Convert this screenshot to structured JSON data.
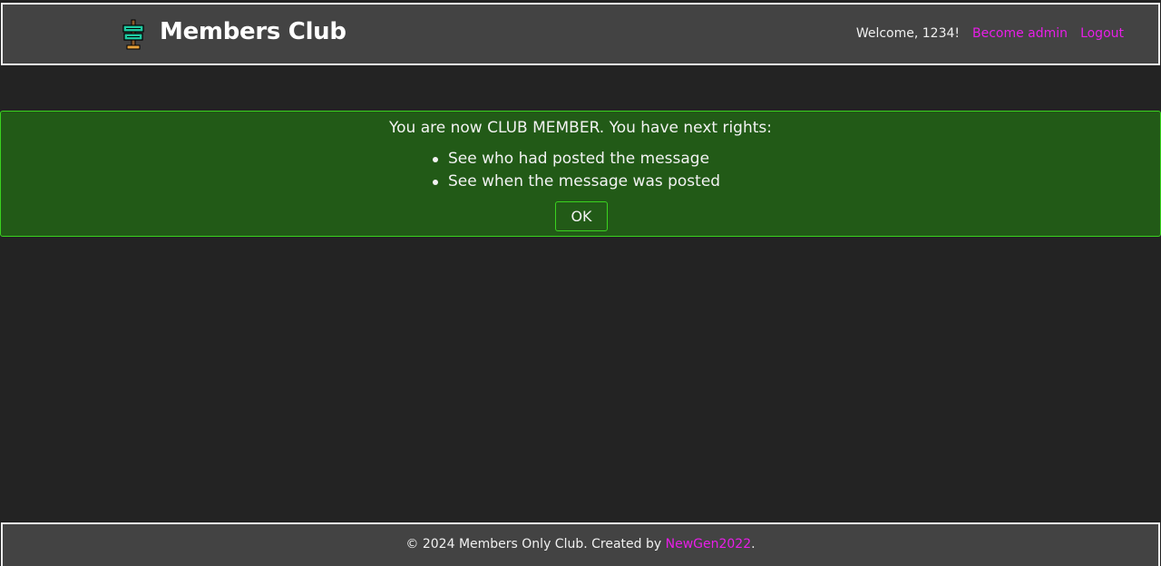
{
  "header": {
    "logo_icon": "members-club-sign-icon",
    "title": "Members Club",
    "welcome": "Welcome, 1234!",
    "become_admin": "Become admin",
    "logout": "Logout"
  },
  "notice": {
    "title": "You are now CLUB MEMBER. You have next rights:",
    "rights": [
      "See who had posted the message",
      "See when the message was posted"
    ],
    "ok_label": "OK"
  },
  "footer": {
    "text_before": "© 2024 Members Only Club. Created by ",
    "author_link": "NewGen2022",
    "text_after": "."
  },
  "colors": {
    "background": "#232323",
    "header_bg": "#434343",
    "accent_link": "#e81ee8",
    "notice_bg": "#225a17",
    "notice_border": "#3ad21f"
  }
}
